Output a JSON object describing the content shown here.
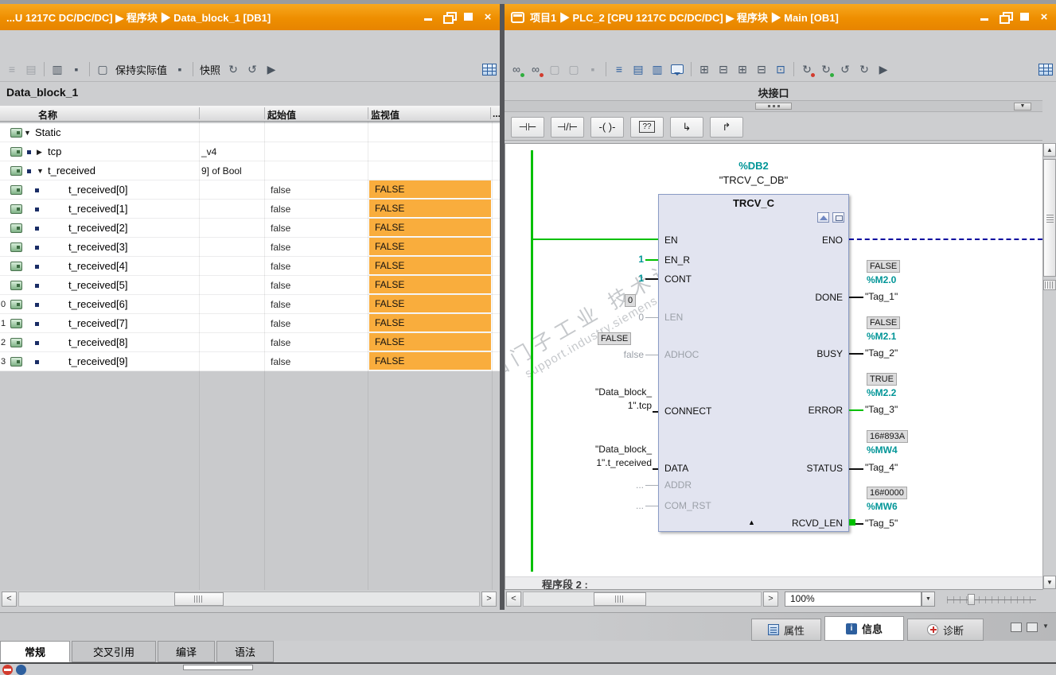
{
  "colors": {
    "titlebar_orange": "#EE8E00",
    "monitor_orange": "#F9AD3D",
    "wire_green": "#00C000",
    "operand_teal": "#009597",
    "eno_blue": "#00009E"
  },
  "icons": {
    "expander_down": "▼",
    "expander_right": "▶",
    "scroll_left": "<",
    "scroll_right": ">",
    "scroll_up": "▲",
    "scroll_down": "▼",
    "dropdown": "▼",
    "ellipsis": "...",
    "overflow": "▶",
    "menu": "≡",
    "grid": "▤",
    "grid_alt": "▥",
    "square": "▢",
    "small_square": "▪",
    "glasses": "∞",
    "box_plus": "⊞",
    "box_minus": "⊟",
    "box_dot": "⊡",
    "rotate_cw": "↻",
    "rotate_ccw": "↺",
    "net_marker": "▸",
    "collapse_handle": "▲",
    "info": "i"
  },
  "left_window": {
    "title": "...U 1217C DC/DC/DC] ▶ 程序块 ▶ Data_block_1 [DB1]",
    "toolbar": {
      "keep_actual_values": "保持实际值",
      "snapshot": "快照"
    },
    "block_name": "Data_block_1",
    "table": {
      "headers": {
        "name": "名称",
        "start_value": "起始值",
        "monitor_value": "监视值",
        "more": "..."
      },
      "rows": [
        {
          "num": "",
          "name": "Static",
          "type": "",
          "start": "",
          "monitor": ""
        },
        {
          "num": "",
          "name": "tcp",
          "type": "_v4",
          "start": "",
          "monitor": ""
        },
        {
          "num": "",
          "name": "t_received",
          "type": "9] of Bool",
          "start": "",
          "monitor": ""
        },
        {
          "num": "",
          "name": "t_received[0]",
          "type": "",
          "start": "false",
          "monitor": "FALSE"
        },
        {
          "num": "",
          "name": "t_received[1]",
          "type": "",
          "start": "false",
          "monitor": "FALSE"
        },
        {
          "num": "",
          "name": "t_received[2]",
          "type": "",
          "start": "false",
          "monitor": "FALSE"
        },
        {
          "num": "",
          "name": "t_received[3]",
          "type": "",
          "start": "false",
          "monitor": "FALSE"
        },
        {
          "num": "",
          "name": "t_received[4]",
          "type": "",
          "start": "false",
          "monitor": "FALSE"
        },
        {
          "num": "",
          "name": "t_received[5]",
          "type": "",
          "start": "false",
          "monitor": "FALSE"
        },
        {
          "num": "0",
          "name": "t_received[6]",
          "type": "",
          "start": "false",
          "monitor": "FALSE"
        },
        {
          "num": "1",
          "name": "t_received[7]",
          "type": "",
          "start": "false",
          "monitor": "FALSE"
        },
        {
          "num": "2",
          "name": "t_received[8]",
          "type": "",
          "start": "false",
          "monitor": "FALSE"
        },
        {
          "num": "3",
          "name": "t_received[9]",
          "type": "",
          "start": "false",
          "monitor": "FALSE"
        }
      ]
    }
  },
  "right_window": {
    "title": "项目1 ▶ PLC_2 [CPU 1217C DC/DC/DC] ▶ 程序块 ▶ Main [OB1]",
    "block_interface_label": "块接口",
    "ladder_buttons": [
      {
        "name": "contact-open",
        "glyph": "⊣⊢"
      },
      {
        "name": "contact-closed",
        "glyph": "⊣/⊢"
      },
      {
        "name": "coil",
        "glyph": "-( )-"
      },
      {
        "name": "empty-box",
        "glyph": "??"
      },
      {
        "name": "open-branch",
        "glyph": "↳"
      },
      {
        "name": "close-branch",
        "glyph": "↱"
      }
    ],
    "network": {
      "db_ref": "%DB2",
      "db_name": "\"TRCV_C_DB\"",
      "block_title": "TRCV_C",
      "pins_left": [
        "EN",
        "EN_R",
        "CONT",
        "LEN",
        "ADHOC",
        "CONNECT",
        "DATA",
        "ADDR",
        "COM_RST"
      ],
      "pins_right": [
        "ENO",
        "DONE",
        "BUSY",
        "ERROR",
        "STATUS",
        "RCVD_LEN"
      ],
      "left": {
        "en_r": "1",
        "cont": "1",
        "len_monitor": "0",
        "len_operand": "0",
        "adhoc_monitor": "FALSE",
        "adhoc_operand": "false",
        "connect_l1": "\"Data_block_",
        "connect_l2": "1\".tcp",
        "data_l1": "\"Data_block_",
        "data_l2": "1\".t_received",
        "addr_operand": "...",
        "com_rst_operand": "..."
      },
      "right": {
        "done": {
          "monitor": "FALSE",
          "address": "%M2.0",
          "tag": "\"Tag_1\""
        },
        "busy": {
          "monitor": "FALSE",
          "address": "%M2.1",
          "tag": "\"Tag_2\""
        },
        "error": {
          "monitor": "TRUE",
          "address": "%M2.2",
          "tag": "\"Tag_3\""
        },
        "status": {
          "monitor": "16#893A",
          "address": "%MW4",
          "tag": "\"Tag_4\""
        },
        "rcvd_len": {
          "monitor": "16#0000",
          "address": "%MW6",
          "tag": "\"Tag_5\""
        }
      },
      "watermark_line1": "西门子工业 技术论坛",
      "watermark_line2": "support.industry.siemens.com",
      "next_network": "程序段 2 :"
    },
    "statusbar": {
      "zoom": "100%"
    }
  },
  "bottom": {
    "inspector_tabs": [
      {
        "label": "属性"
      },
      {
        "label": "信息"
      },
      {
        "label": "诊断"
      }
    ],
    "editor_tabs": [
      {
        "label": "常规"
      },
      {
        "label": "交叉引用"
      },
      {
        "label": "编译"
      },
      {
        "label": "语法"
      }
    ]
  }
}
